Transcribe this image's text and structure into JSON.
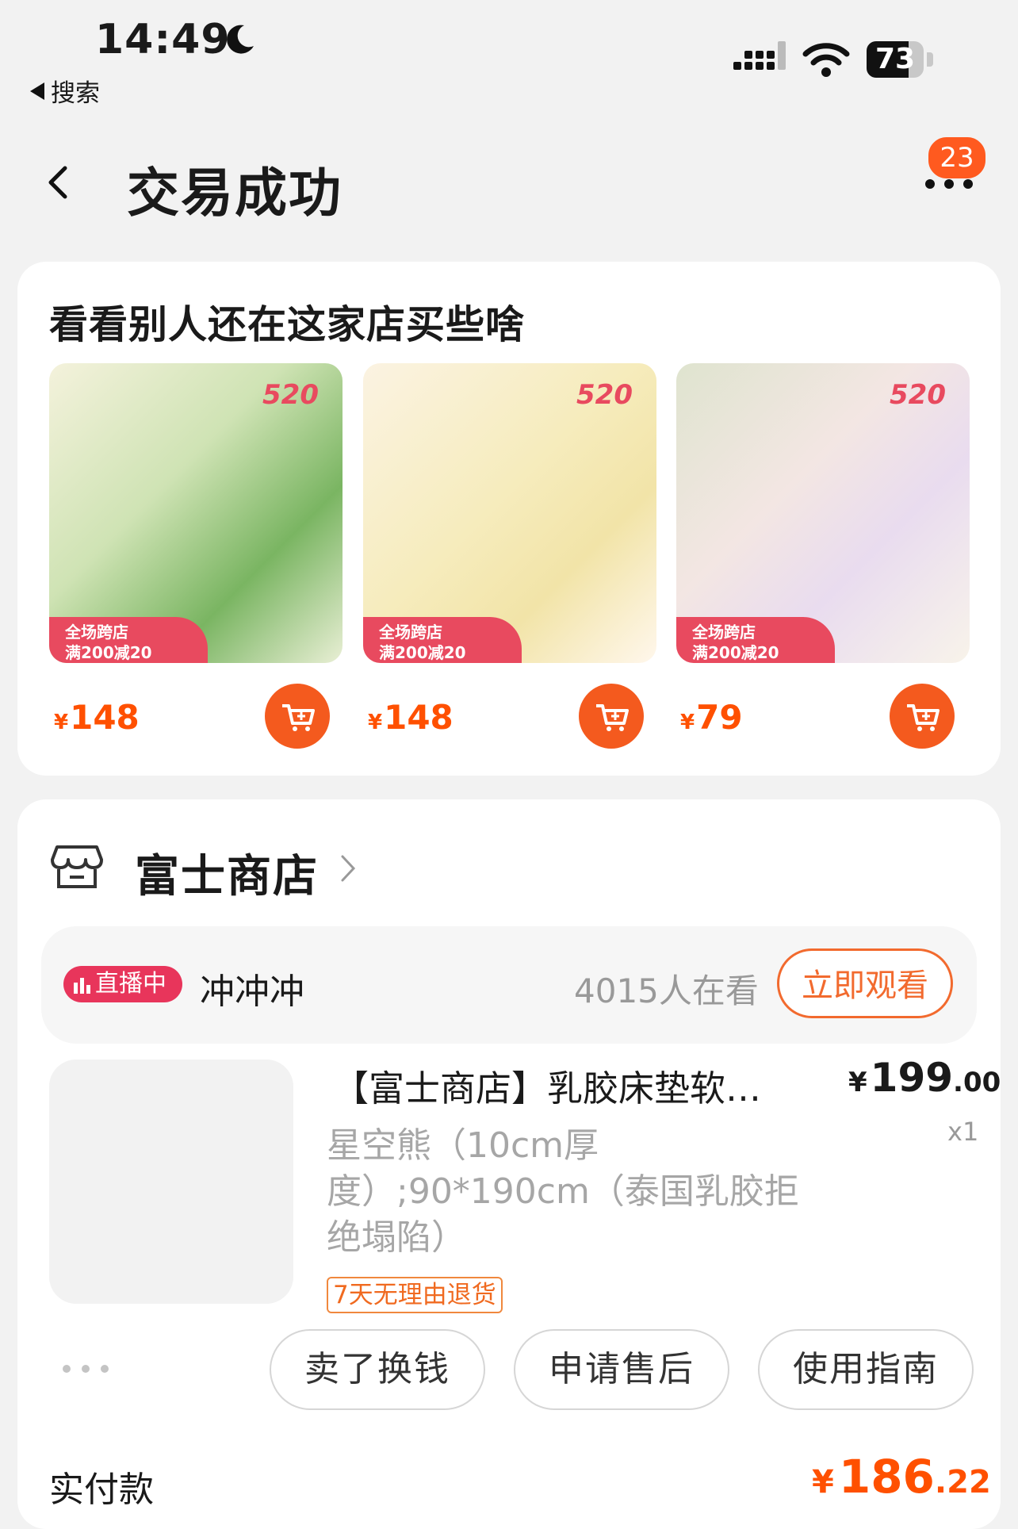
{
  "status_bar": {
    "time": "14:49",
    "back_app": "搜索",
    "battery": "73",
    "battery_level": 0.73
  },
  "header": {
    "title": "交易成功",
    "badge_count": "23"
  },
  "recommend": {
    "title": "看看别人还在这家店买些啥",
    "promo_line1": "全场跨店",
    "promo_line2": "满200减20",
    "tag": "520",
    "currency": "¥",
    "items": [
      {
        "price": "148"
      },
      {
        "price": "148"
      },
      {
        "price": "79"
      }
    ]
  },
  "store": {
    "name": "富士商店",
    "live_badge": "直播中",
    "live_title": "冲冲冲",
    "viewers": "4015人在看",
    "watch_button": "立即观看",
    "item": {
      "title": "【富士商店】乳胶床垫软…",
      "currency": "¥",
      "price_int": "199",
      "price_dec": ".00",
      "qty": "x1",
      "sku": "星空熊（10cm厚度）;90*190cm（泰国乳胶拒绝塌陷）",
      "return_tag": "7天无理由退货"
    },
    "actions": [
      "卖了换钱",
      "申请售后",
      "使用指南"
    ],
    "paid_label": "实付款",
    "paid_currency": "¥",
    "paid_int": "186",
    "paid_dec": ".22"
  }
}
